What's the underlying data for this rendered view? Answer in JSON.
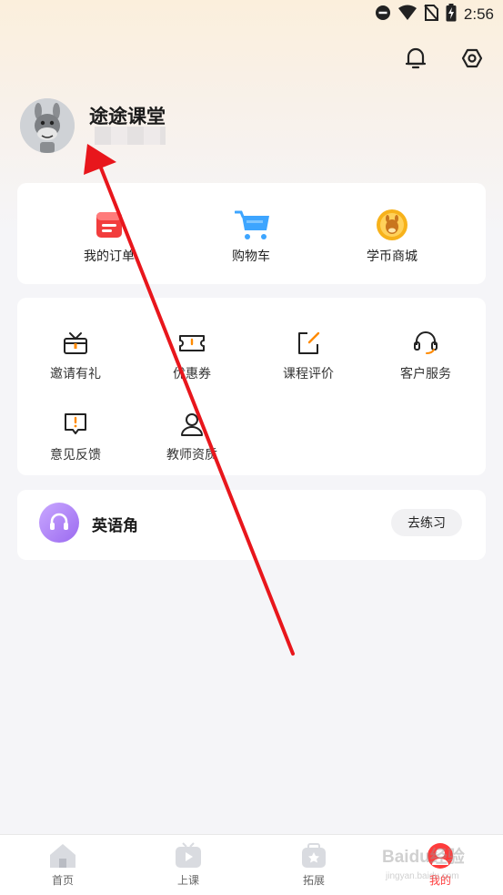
{
  "status_bar": {
    "time": "2:56",
    "icons": [
      "do-not-disturb-icon",
      "wifi-icon",
      "no-sim-icon",
      "battery-charging-icon"
    ]
  },
  "header": {
    "icons": [
      "bell-icon",
      "settings-icon"
    ]
  },
  "profile": {
    "username": "途途课堂"
  },
  "quick_actions": [
    {
      "label": "我的订单",
      "icon": "order-icon"
    },
    {
      "label": "购物车",
      "icon": "cart-icon"
    },
    {
      "label": "学币商城",
      "icon": "coin-mall-icon"
    }
  ],
  "services": [
    {
      "label": "邀请有礼",
      "icon": "gift-icon"
    },
    {
      "label": "优惠券",
      "icon": "coupon-icon"
    },
    {
      "label": "课程评价",
      "icon": "edit-icon"
    },
    {
      "label": "客户服务",
      "icon": "headset-icon"
    },
    {
      "label": "意见反馈",
      "icon": "feedback-icon"
    },
    {
      "label": "教师资质",
      "icon": "teacher-icon"
    }
  ],
  "english_corner": {
    "title": "英语角",
    "button": "去练习",
    "icon": "headphone-icon"
  },
  "tabbar": {
    "active": "我的",
    "tabs": [
      {
        "label": "首页",
        "icon": "home-icon"
      },
      {
        "label": "上课",
        "icon": "tv-icon"
      },
      {
        "label": "拓展",
        "icon": "star-bag-icon"
      },
      {
        "label": "我的",
        "icon": "profile-icon"
      }
    ]
  },
  "watermark": {
    "text": "Baidu经验",
    "subtext": "jingyan.baidu.com"
  },
  "colors": {
    "accent": "#ff3b3b",
    "annotation_arrow": "#e8161c"
  }
}
